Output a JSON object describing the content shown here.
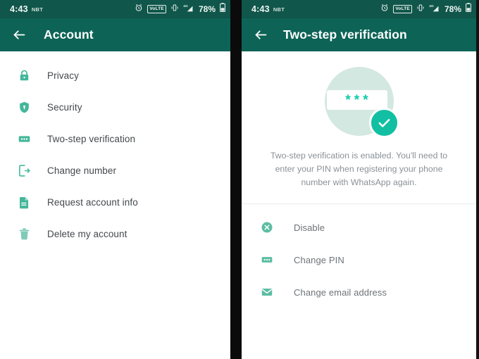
{
  "theme": {
    "status_bar_bg": "#10564a",
    "app_bar_bg": "#0d6356",
    "accent_teal": "#44b79a",
    "accent_bright": "#12bfa2",
    "hero_circle": "#d3e8e1",
    "text_primary": "#43484b",
    "text_muted": "#8b9196"
  },
  "status_bar": {
    "time": "4:43",
    "timezone": "NBT",
    "alarm_icon": "alarm-clock-icon",
    "network_badge": "VoLTE",
    "vibrate_icon": "vibrate-icon",
    "signal_icon": "signal-4g-icon",
    "battery_percent": "78%",
    "battery_icon": "battery-icon"
  },
  "left_screen": {
    "back_icon": "back-arrow-icon",
    "title": "Account",
    "items": [
      {
        "label": "Privacy",
        "icon": "lock-icon"
      },
      {
        "label": "Security",
        "icon": "shield-icon"
      },
      {
        "label": "Two-step verification",
        "icon": "pin-dots-icon"
      },
      {
        "label": "Change number",
        "icon": "phone-arrow-icon"
      },
      {
        "label": "Request account info",
        "icon": "document-icon"
      },
      {
        "label": "Delete my account",
        "icon": "trash-icon"
      }
    ]
  },
  "right_screen": {
    "back_icon": "back-arrow-icon",
    "title": "Two-step verification",
    "hero": {
      "pin_mask": [
        "*",
        "*",
        "*"
      ],
      "check_icon": "check-circle-icon"
    },
    "description": "Two-step verification is enabled. You'll need to enter your PIN when registering your phone number with WhatsApp again.",
    "actions": [
      {
        "label": "Disable",
        "icon": "close-circle-icon"
      },
      {
        "label": "Change PIN",
        "icon": "pin-dots-icon"
      },
      {
        "label": "Change email address",
        "icon": "envelope-icon"
      }
    ]
  }
}
